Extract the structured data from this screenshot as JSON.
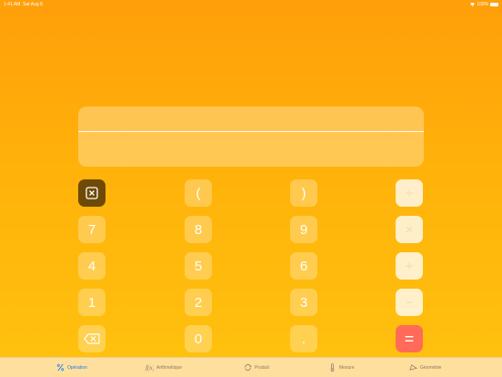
{
  "status_bar": {
    "time": "1:41 AM",
    "date": "Sat Aug 8",
    "battery": "100%"
  },
  "display": {
    "expression": "",
    "result": ""
  },
  "keypad": {
    "rows": [
      [
        {
          "label": "",
          "kind": "clear",
          "icon": "clear-x-icon"
        },
        {
          "label": "(",
          "kind": "fn"
        },
        {
          "label": ")",
          "kind": "fn"
        },
        {
          "label": "÷",
          "kind": "op"
        }
      ],
      [
        {
          "label": "7"
        },
        {
          "label": "8"
        },
        {
          "label": "9"
        },
        {
          "label": "×",
          "kind": "op"
        }
      ],
      [
        {
          "label": "4"
        },
        {
          "label": "5"
        },
        {
          "label": "6"
        },
        {
          "label": "+",
          "kind": "op"
        }
      ],
      [
        {
          "label": "1"
        },
        {
          "label": "2"
        },
        {
          "label": "3"
        },
        {
          "label": "−",
          "kind": "op"
        }
      ],
      [
        {
          "label": "",
          "kind": "del",
          "icon": "backspace-icon"
        },
        {
          "label": "0"
        },
        {
          "label": ".",
          "kind": "fn"
        },
        {
          "label": "=",
          "kind": "eq"
        }
      ]
    ]
  },
  "tabs": [
    {
      "label": "Opération",
      "icon": "percent-icon",
      "active": true
    },
    {
      "label": "Arithmétique",
      "icon": "f-of-x-icon",
      "active": false
    },
    {
      "label": "Produit",
      "icon": "cycle-icon",
      "active": false
    },
    {
      "label": "Mesure",
      "icon": "thermometer-icon",
      "active": false
    },
    {
      "label": "Géométrie",
      "icon": "triangle-icon",
      "active": false
    }
  ],
  "colors": {
    "accent": "#1e7cf2",
    "equals": "#ff6b58",
    "clear": "#6e4a06"
  }
}
